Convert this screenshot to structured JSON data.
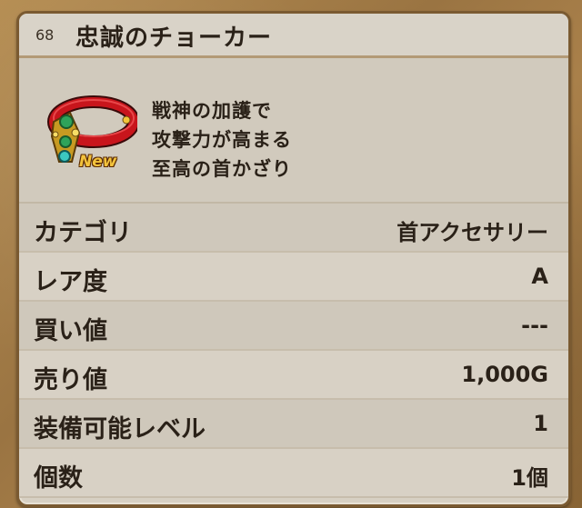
{
  "item": {
    "number": "68",
    "name": "忠誠のチョーカー",
    "badge": "New",
    "icon": "red-choker-icon",
    "description": [
      "戦神の加護で",
      "攻撃力が高まる",
      "至高の首かざり"
    ]
  },
  "stats": [
    {
      "label": "カテゴリ",
      "value": "首アクセサリー"
    },
    {
      "label": "レア度",
      "value": "A"
    },
    {
      "label": "買い値",
      "value": "---"
    },
    {
      "label": "売り値",
      "value": "1,000G"
    },
    {
      "label": "装備可能レベル",
      "value": "1"
    },
    {
      "label": "個数",
      "value": "1個"
    }
  ],
  "colors": {
    "panel_bg": "#d7d0c3",
    "frame": "#9a7442",
    "text": "#2a2118",
    "badge": "#f3c33c"
  }
}
